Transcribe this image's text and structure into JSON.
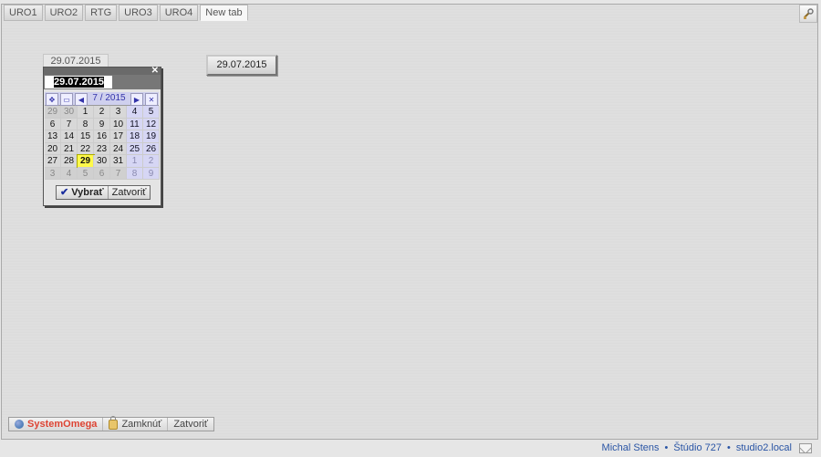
{
  "tabs": [
    {
      "label": "URO1"
    },
    {
      "label": "URO2"
    },
    {
      "label": "RTG"
    },
    {
      "label": "URO3"
    },
    {
      "label": "URO4"
    },
    {
      "label": "New tab"
    }
  ],
  "date_field": {
    "label": "29.07.2015"
  },
  "date_button": {
    "label": "29.07.2015"
  },
  "calendar": {
    "input_value": "29.07.2015",
    "month_label": "7 / 2015",
    "close_glyph": "✕",
    "days": [
      [
        "29",
        "30",
        "1",
        "2",
        "3",
        "4",
        "5"
      ],
      [
        "6",
        "7",
        "8",
        "9",
        "10",
        "11",
        "12"
      ],
      [
        "13",
        "14",
        "15",
        "16",
        "17",
        "18",
        "19"
      ],
      [
        "20",
        "21",
        "22",
        "23",
        "24",
        "25",
        "26"
      ],
      [
        "27",
        "28",
        "29",
        "30",
        "31",
        "1",
        "2"
      ],
      [
        "3",
        "4",
        "5",
        "6",
        "7",
        "8",
        "9"
      ]
    ],
    "select_label": "Vybrať",
    "close_label": "Zatvoriť"
  },
  "bottom_bar": {
    "app_name": "SystemOmega",
    "lock_label": "Zamknúť",
    "close_label": "Zatvoriť"
  },
  "status": {
    "user": "Michal Stens",
    "studio": "Štúdio 727",
    "host": "studio2.local"
  },
  "icons": {
    "corner": "tools-icon",
    "mail": "mail-icon"
  }
}
